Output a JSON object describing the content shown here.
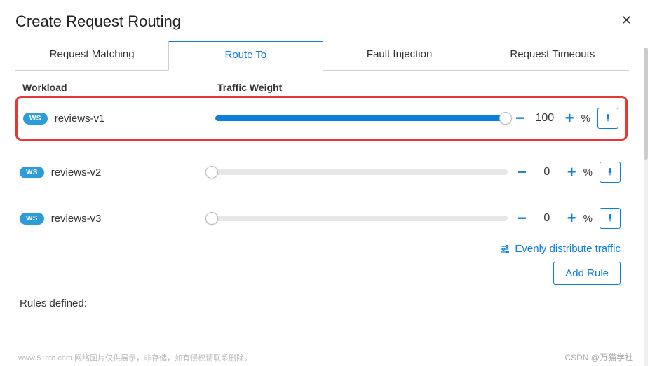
{
  "modal": {
    "title": "Create Request Routing"
  },
  "tabs": [
    {
      "label": "Request Matching",
      "active": false
    },
    {
      "label": "Route To",
      "active": true
    },
    {
      "label": "Fault Injection",
      "active": false
    },
    {
      "label": "Request Timeouts",
      "active": false
    }
  ],
  "headers": {
    "workload": "Workload",
    "weight": "Traffic Weight"
  },
  "badge": "WS",
  "workloads": [
    {
      "name": "reviews-v1",
      "weight": 100,
      "highlighted": true
    },
    {
      "name": "reviews-v2",
      "weight": 0,
      "highlighted": false
    },
    {
      "name": "reviews-v3",
      "weight": 0,
      "highlighted": false
    }
  ],
  "percent_symbol": "%",
  "actions": {
    "evenly": "Evenly distribute traffic",
    "add_rule": "Add Rule"
  },
  "rules_defined": "Rules defined:",
  "footer_left": "www.51cto.com 网络图片仅供展示，非存储，如有侵权请联系删除。",
  "footer_right": "CSDN @万猫学社"
}
